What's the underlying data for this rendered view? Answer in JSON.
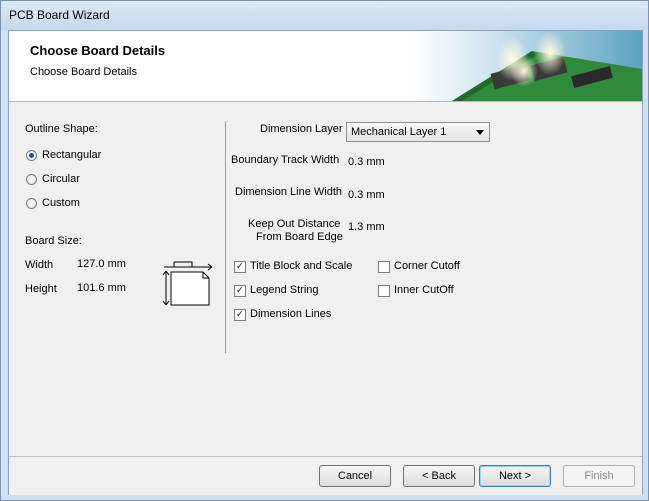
{
  "window": {
    "title": "PCB Board Wizard"
  },
  "header": {
    "title": "Choose Board Details",
    "subtitle": "Choose Board Details"
  },
  "outline": {
    "label": "Outline Shape:",
    "options": [
      {
        "label": "Rectangular",
        "selected": true
      },
      {
        "label": "Circular",
        "selected": false
      },
      {
        "label": "Custom",
        "selected": false
      }
    ]
  },
  "board_size": {
    "label": "Board Size:",
    "width_label": "Width",
    "width_value": "127.0 mm",
    "height_label": "Height",
    "height_value": "101.6 mm"
  },
  "details": {
    "dimension_layer_label": "Dimension Layer",
    "dimension_layer_value": "Mechanical Layer 1",
    "boundary_track_label": "Boundary Track Width",
    "boundary_track_value": "0.3 mm",
    "dimension_line_label": "Dimension Line Width",
    "dimension_line_value": "0.3 mm",
    "keepout_label_1": "Keep Out Distance",
    "keepout_label_2": "From Board Edge",
    "keepout_value": "1.3 mm"
  },
  "checkboxes": [
    {
      "label": "Title Block and Scale",
      "checked": true
    },
    {
      "label": "Legend String",
      "checked": true
    },
    {
      "label": "Dimension Lines",
      "checked": true
    },
    {
      "label": "Corner Cutoff",
      "checked": false
    },
    {
      "label": "Inner CutOff",
      "checked": false
    }
  ],
  "buttons": {
    "cancel": "Cancel",
    "back": "< Back",
    "next": "Next >",
    "finish": "Finish"
  },
  "colors": {
    "accent": "#2a4f86",
    "titlebar": "#cfe0f2"
  }
}
